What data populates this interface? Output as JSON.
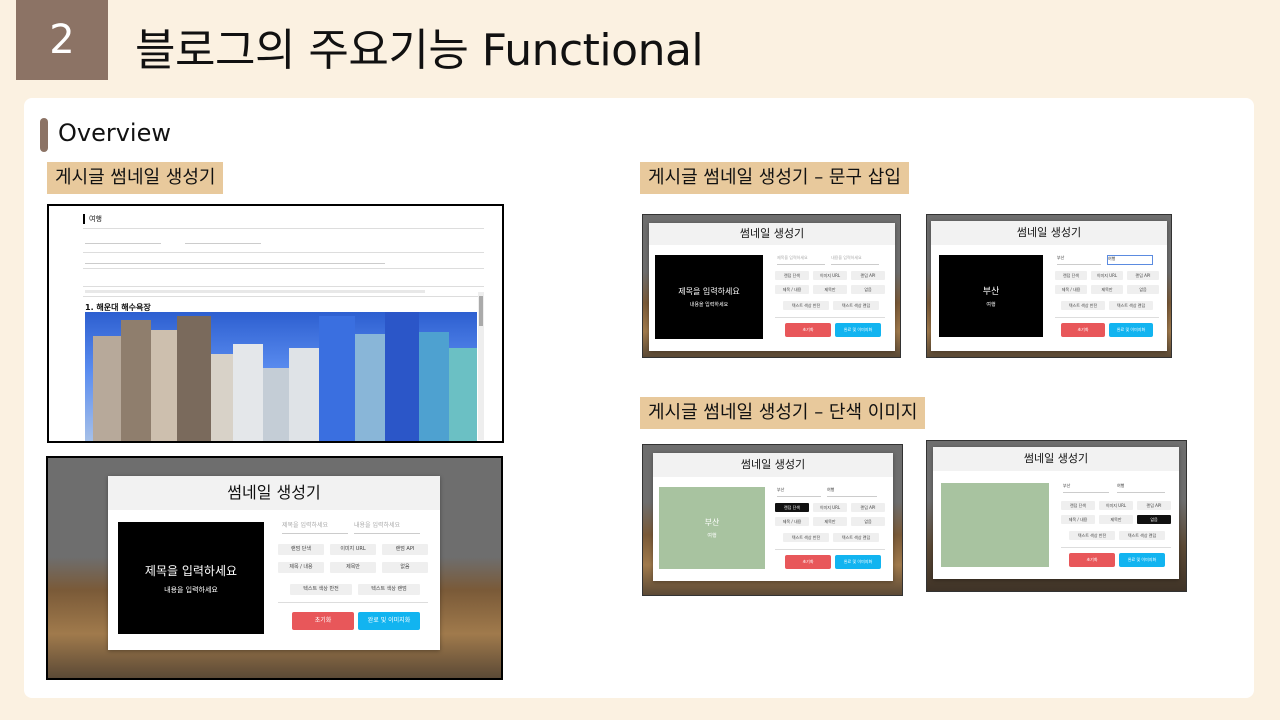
{
  "header": {
    "number": "2",
    "title": "블로그의 주요기능 Functional"
  },
  "overview": {
    "label": "Overview"
  },
  "sections": {
    "thumbnail": "게시글 썸네일 생성기",
    "text_insert": "게시글 썸네일 생성기 – 문구 삽입",
    "solid_image": "게시글 썸네일 생성기 – 단색 이미지"
  },
  "blog_shot": {
    "category": "여행",
    "heading": "1. 해운대 해수욕장"
  },
  "generator": {
    "title": "썸네일 생성기",
    "preview_title": "제목을 입력하세요",
    "preview_subtitle": "내용을 입력하세요",
    "title_placeholder": "제목을 입력하세요",
    "content_placeholder": "내용을 입력하세요",
    "buttons": [
      "랜덤 단색",
      "이미지 URL",
      "랜덤 API",
      "제목 / 내용",
      "제목만",
      "없음",
      "텍스트 색상 반전",
      "텍스트 색상 랜덤"
    ],
    "reset": "초기화",
    "finish": "완료 및 이미지화"
  },
  "samples": {
    "title_value": "부산",
    "content_value": "여행"
  },
  "colors": {
    "accent": "#8c7365",
    "tag": "#e8c99c",
    "background": "#fbf1e1",
    "solid_green": "#a8c3a0",
    "reset_red": "#e8575a",
    "finish_blue": "#12b4f0"
  }
}
